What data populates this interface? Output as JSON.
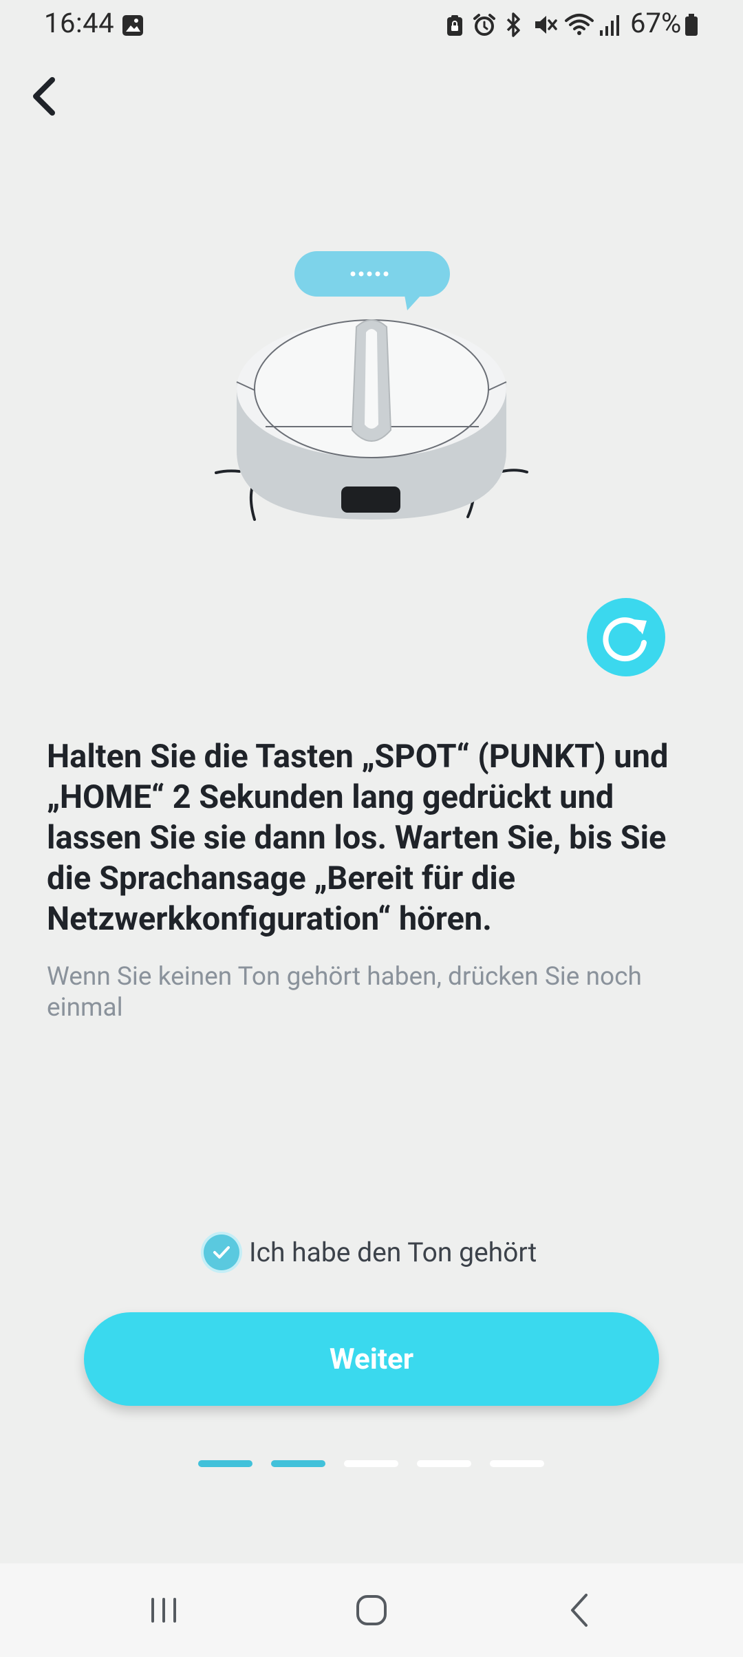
{
  "status_bar": {
    "time": "16:44",
    "battery": "67%",
    "icons": [
      "gallery-icon",
      "clipboard-lock-icon",
      "alarm-icon",
      "bluetooth-icon",
      "mute-icon",
      "wifi-icon",
      "signal-icon",
      "battery-icon"
    ]
  },
  "header": {
    "back_icon": "chevron-left-icon"
  },
  "illustration": {
    "speech_bubble_text": "•••••",
    "accent_color": "#7dd3ea"
  },
  "main": {
    "instruction": "Halten Sie die Tasten „SPOT“ (PUNKT) und „HOME“ 2 Sekunden lang gedrückt und lassen Sie sie dann los. Warten Sie, bis Sie die Sprachansage „Bereit für die Netzwerkkonfiguration“ hören.",
    "hint": "Wenn Sie keinen Ton gehört haben, drücken Sie noch einmal",
    "replay_icon": "replay-icon",
    "checkbox": {
      "label": "Ich habe den Ton gehört",
      "checked": true
    },
    "next_button": "Weiter"
  },
  "pager": {
    "total": 5,
    "active": [
      true,
      true,
      false,
      false,
      false
    ]
  },
  "colors": {
    "accent": "#3ad9ee",
    "pager_active": "#41c1da",
    "background": "#eeefee"
  },
  "nav_bar": {
    "icons": [
      "recent-apps-icon",
      "home-icon",
      "back-icon"
    ]
  }
}
